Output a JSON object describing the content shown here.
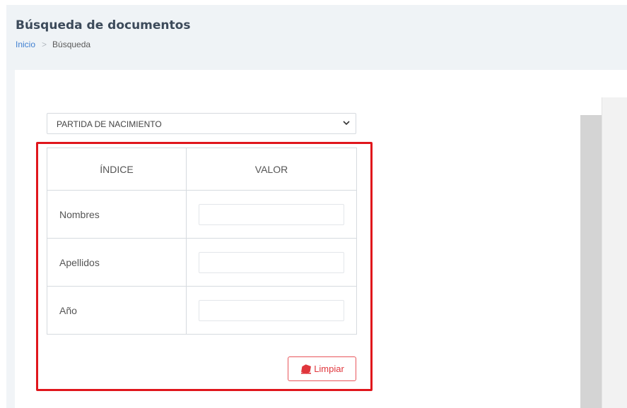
{
  "header": {
    "title": "Búsqueda de documentos",
    "breadcrumb": {
      "home": "Inicio",
      "separator": ">",
      "current": "Búsqueda"
    }
  },
  "document_type": {
    "selected": "PARTIDA DE NACIMIENTO"
  },
  "index_table": {
    "columns": [
      "ÍNDICE",
      "VALOR"
    ],
    "rows": [
      {
        "label": "Nombres",
        "value": ""
      },
      {
        "label": "Apellidos",
        "value": ""
      },
      {
        "label": "Año",
        "value": ""
      }
    ]
  },
  "actions": {
    "clear_label": "Limpiar",
    "clear_icon": "eraser-icon"
  },
  "colors": {
    "highlight": "#e0161c",
    "link": "#3f7fd1",
    "header_bg": "#eff3f6",
    "danger": "#e0363c"
  }
}
